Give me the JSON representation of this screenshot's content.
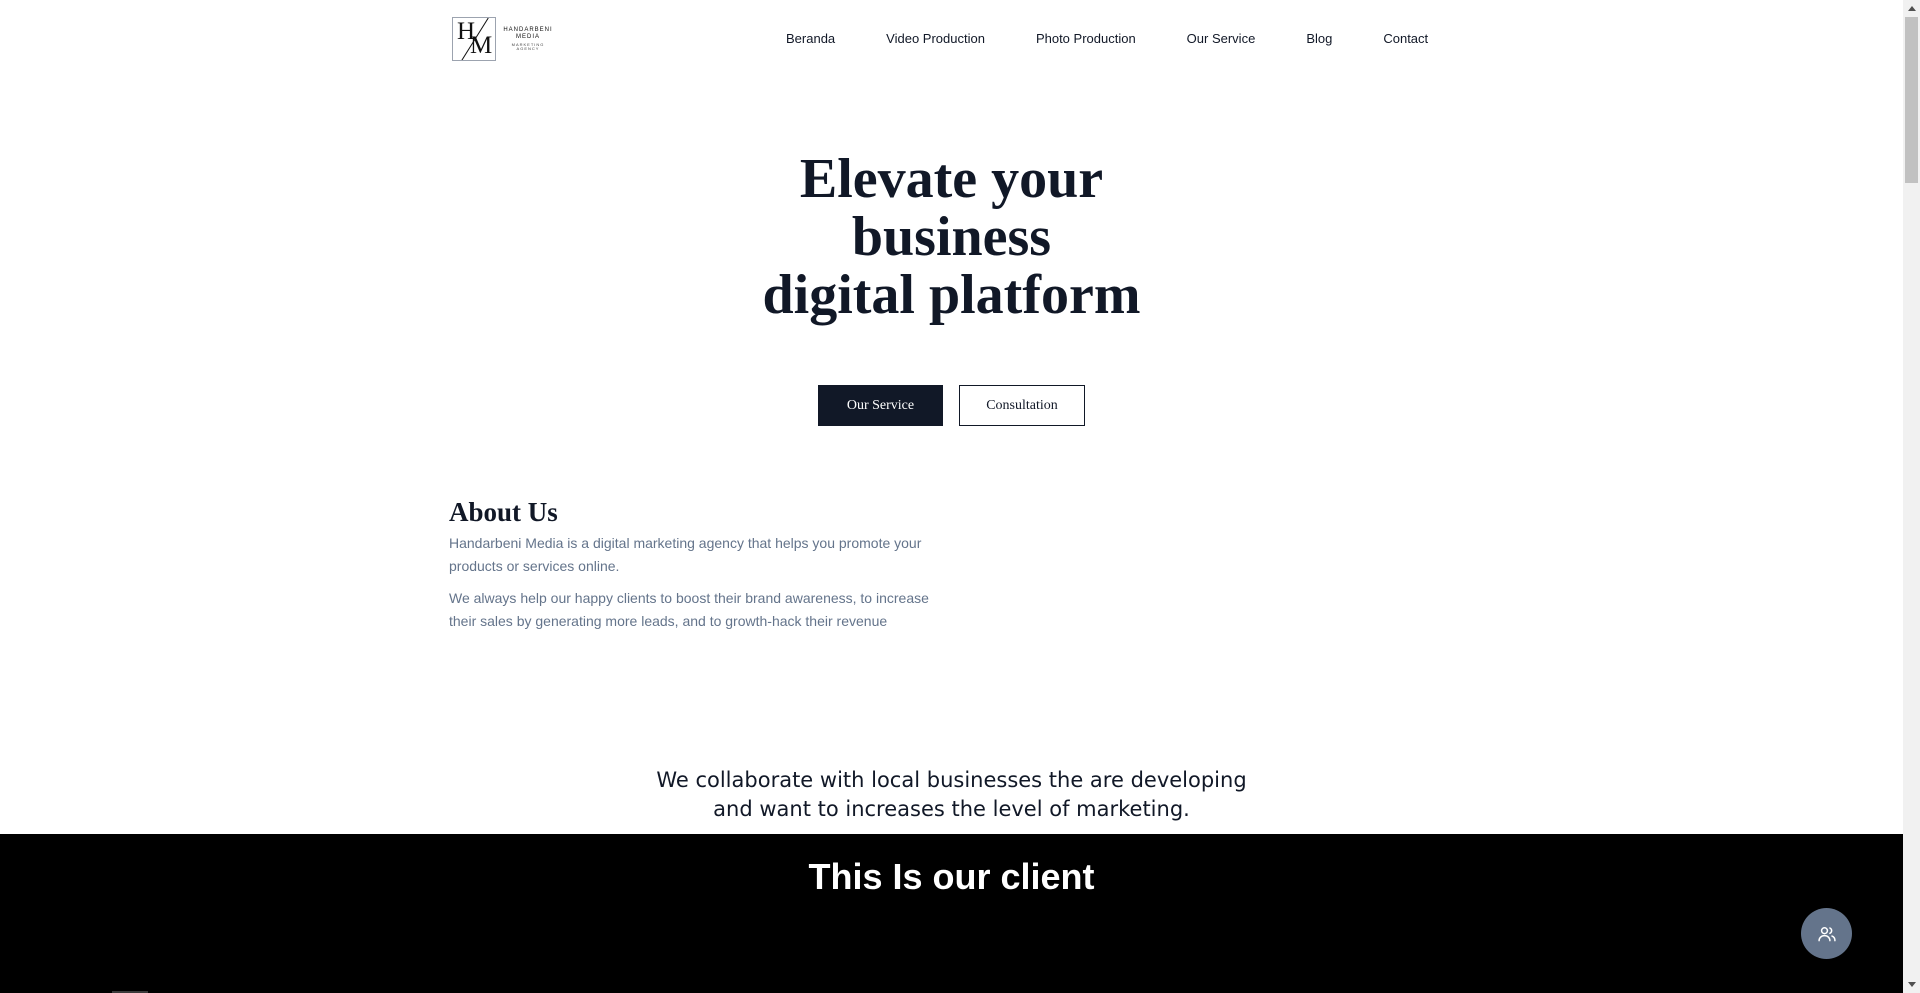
{
  "logo": {
    "line1": "HANDARBENI",
    "line2": "MEDIA",
    "line3": "MARKETING AGENCY",
    "mark_h": "H",
    "mark_m": "M"
  },
  "nav": {
    "items": [
      {
        "label": "Beranda"
      },
      {
        "label": "Video Production"
      },
      {
        "label": "Photo Production"
      },
      {
        "label": "Our Service"
      },
      {
        "label": "Blog"
      },
      {
        "label": "Contact"
      }
    ]
  },
  "hero": {
    "title_lines": [
      "Elevate your",
      "business",
      "digital platform"
    ],
    "primary_button": "Our Service",
    "secondary_button": "Consultation"
  },
  "about": {
    "heading": "About Us",
    "paragraph1": "Handarbeni Media is a digital marketing agency that helps you promote your products or services online.",
    "paragraph2": "We always help our happy clients to boost their brand awareness, to increase their sales by generating more leads, and to growth-hack their revenue"
  },
  "collaborate": {
    "lines": [
      "We collaborate with local businesses the are developing",
      "and want to increases the level of marketing."
    ]
  },
  "clients": {
    "heading": "This Is our client"
  },
  "floating_button": {
    "icon": "users-icon"
  },
  "colors": {
    "primary": "#111827",
    "muted_text": "#64748b",
    "band": "#000000",
    "float_button": "#64748b"
  }
}
